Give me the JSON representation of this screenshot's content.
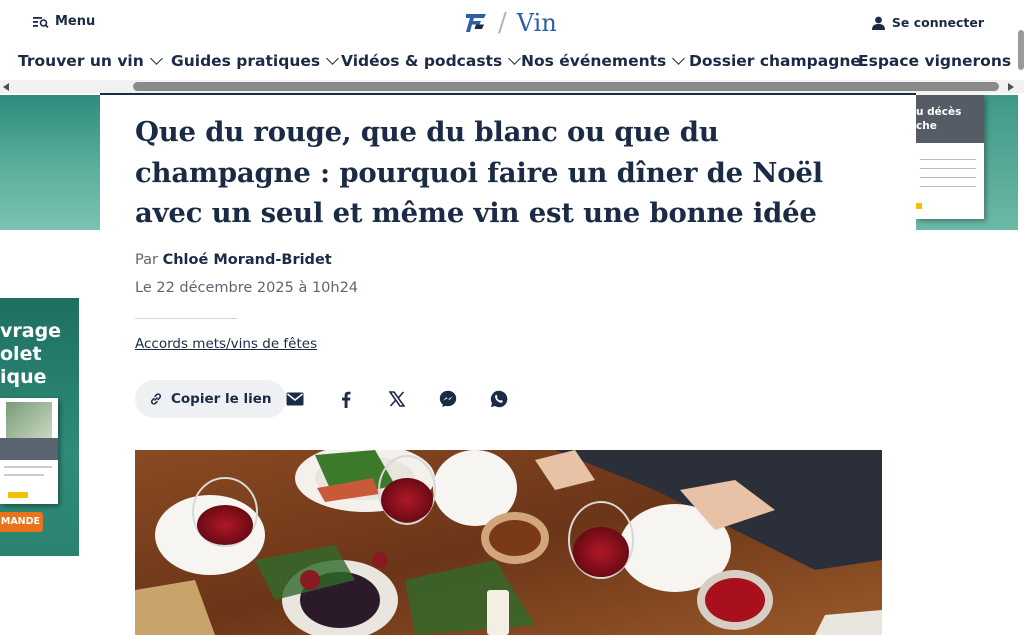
{
  "header": {
    "menu_label": "Menu",
    "section_label": "Vin",
    "login_label": "Se connecter"
  },
  "nav": {
    "items": [
      {
        "label": "Trouver un vin",
        "has_dropdown": true
      },
      {
        "label": "Guides pratiques",
        "has_dropdown": true
      },
      {
        "label": "Vidéos & podcasts",
        "has_dropdown": true
      },
      {
        "label": "Nos événements",
        "has_dropdown": true
      },
      {
        "label": "Dossier champagne",
        "has_dropdown": false
      },
      {
        "label": "Espace vignerons",
        "has_dropdown": false
      }
    ]
  },
  "ads": {
    "right_book_title": "u décès\nche",
    "left_lines": [
      "vrage",
      "olet",
      "ique"
    ],
    "left_cta": "MANDE"
  },
  "article": {
    "title": "Que du rouge, que du blanc ou que du champagne : pourquoi faire un dîner de Noël avec un seul et même vin est une bonne idée",
    "byline_prefix": "Par",
    "author": "Chloé Morand-Bridet",
    "date": "Le 22 décembre 2025 à 10h24",
    "tag": "Accords mets/vins de fêtes",
    "copy_link_label": "Copier le lien"
  },
  "share": {
    "icons": [
      "email-icon",
      "facebook-icon",
      "x-icon",
      "messenger-icon",
      "whatsapp-icon"
    ]
  },
  "colors": {
    "navy": "#1b2b45",
    "brand_blue": "#2f5ea8",
    "ad_teal": "#2e8c7c",
    "ad_orange": "#e8731a"
  }
}
